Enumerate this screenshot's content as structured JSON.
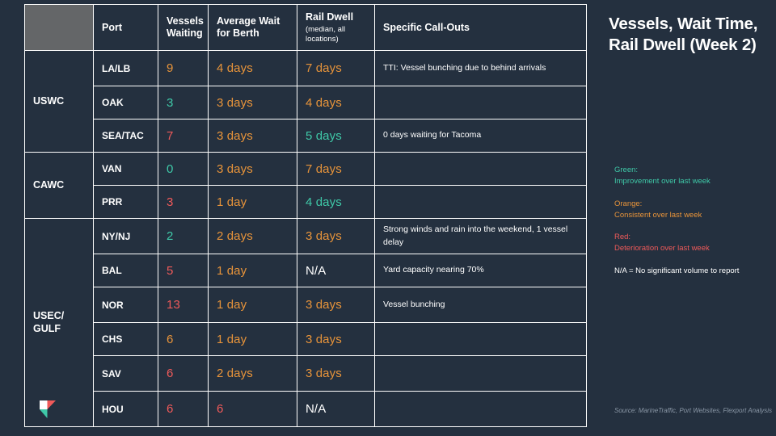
{
  "colors": {
    "background": "#24303f",
    "header_fill": "#646668",
    "border": "#ffffff",
    "green": "#3fc9a8",
    "orange": "#e8943a",
    "red": "#f05a5a",
    "white": "#ffffff",
    "source_text": "#8a97a6"
  },
  "title": "Vessels, Wait Time, Rail Dwell (Week 2)",
  "table": {
    "headers": {
      "region": "",
      "port": "Port",
      "vessels": "Vessels Waiting",
      "wait": "Average Wait for Berth",
      "dwell": "Rail Dwell",
      "dwell_sub": "(median, all locations)",
      "callouts": "Specific Call-Outs"
    },
    "groups": [
      {
        "region": "USWC",
        "rows": [
          {
            "port": "LA/LB",
            "vessels": "9",
            "vessels_color": "orange",
            "wait": "4 days",
            "wait_color": "orange",
            "dwell": "7 days",
            "dwell_color": "orange",
            "callout": "TTI: Vessel bunching due to behind arrivals"
          },
          {
            "port": "OAK",
            "vessels": "3",
            "vessels_color": "green",
            "wait": "3 days",
            "wait_color": "orange",
            "dwell": "4 days",
            "dwell_color": "orange",
            "callout": ""
          },
          {
            "port": "SEA/TAC",
            "vessels": "7",
            "vessels_color": "red",
            "wait": "3 days",
            "wait_color": "orange",
            "dwell": "5 days",
            "dwell_color": "green",
            "callout": "0 days waiting for Tacoma"
          }
        ]
      },
      {
        "region": "CAWC",
        "rows": [
          {
            "port": "VAN",
            "vessels": "0",
            "vessels_color": "green",
            "wait": "3 days",
            "wait_color": "orange",
            "dwell": "7 days",
            "dwell_color": "orange",
            "callout": ""
          },
          {
            "port": "PRR",
            "vessels": "3",
            "vessels_color": "red",
            "wait": "1 day",
            "wait_color": "orange",
            "dwell": "4 days",
            "dwell_color": "green",
            "callout": ""
          }
        ]
      },
      {
        "region": "USEC/ GULF",
        "rows": [
          {
            "port": "NY/NJ",
            "vessels": "2",
            "vessels_color": "green",
            "wait": "2 days",
            "wait_color": "orange",
            "dwell": "3 days",
            "dwell_color": "orange",
            "callout": "Strong winds and rain into the weekend, 1 vessel delay"
          },
          {
            "port": "BAL",
            "vessels": "5",
            "vessels_color": "red",
            "wait": "1 day",
            "wait_color": "orange",
            "dwell": "N/A",
            "dwell_color": "white",
            "callout": "Yard capacity nearing 70%"
          },
          {
            "port": "NOR",
            "vessels": "13",
            "vessels_color": "red",
            "wait": "1 day",
            "wait_color": "orange",
            "dwell": "3 days",
            "dwell_color": "orange",
            "callout": "Vessel bunching"
          },
          {
            "port": "CHS",
            "vessels": "6",
            "vessels_color": "orange",
            "wait": "1 day",
            "wait_color": "orange",
            "dwell": "3 days",
            "dwell_color": "orange",
            "callout": ""
          },
          {
            "port": "SAV",
            "vessels": "6",
            "vessels_color": "red",
            "wait": "2 days",
            "wait_color": "orange",
            "dwell": "3 days",
            "dwell_color": "orange",
            "callout": ""
          },
          {
            "port": "HOU",
            "vessels": "6",
            "vessels_color": "red",
            "wait": "6",
            "wait_color": "red",
            "dwell": "N/A",
            "dwell_color": "white",
            "callout": ""
          }
        ]
      }
    ]
  },
  "legend": {
    "items": [
      {
        "term": "Green:",
        "desc": "Improvement over last week",
        "color": "green"
      },
      {
        "term": "Orange:",
        "desc": "Consistent over last week",
        "color": "orange"
      },
      {
        "term": "Red:",
        "desc": "Deterioration over last week",
        "color": "red"
      }
    ],
    "na_note": "N/A = No significant volume to report"
  },
  "source": "Source: MarineTraffic, Port Websites, Flexport Analysis",
  "logo": {
    "name": "flexport-logo"
  }
}
